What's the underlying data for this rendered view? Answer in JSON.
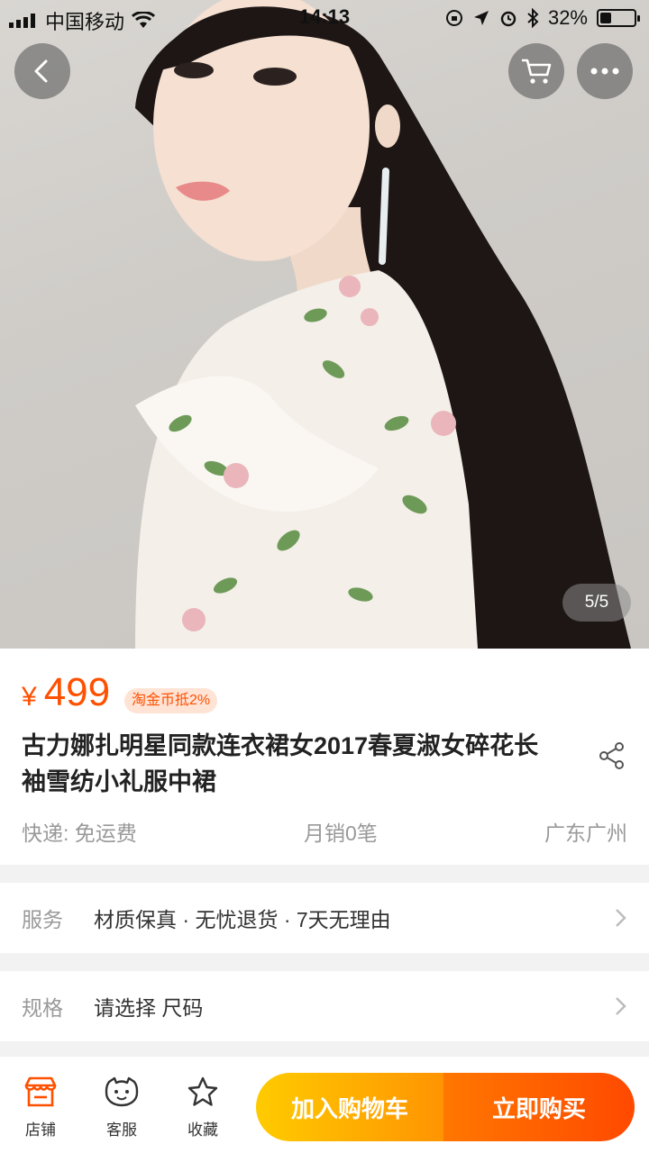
{
  "status_bar": {
    "carrier": "中国移动",
    "time": "14:13",
    "battery_percent": "32%",
    "battery_level": 0.32
  },
  "gallery": {
    "pager": "5/5",
    "current": 5,
    "total": 5
  },
  "product": {
    "currency": "¥",
    "price": "499",
    "coin_badge": "淘金币抵2%",
    "title": "古力娜扎明星同款连衣裙女2017春夏淑女碎花长袖雪纺小礼服中裙",
    "shipping": "快递: 免运费",
    "monthly_sales": "月销0笔",
    "location": "广东广州"
  },
  "service": {
    "label": "服务",
    "value": "材质保真 · 无忧退货 · 7天无理由"
  },
  "spec": {
    "label": "规格",
    "value": "请选择 尺码"
  },
  "bottom_bar": {
    "shop": "店铺",
    "customer_service": "客服",
    "favorite": "收藏",
    "add_to_cart": "加入购物车",
    "buy_now": "立即购买"
  },
  "colors": {
    "accent": "#ff5000",
    "cart_button": "#ff9402",
    "buy_button": "#ff4900"
  }
}
